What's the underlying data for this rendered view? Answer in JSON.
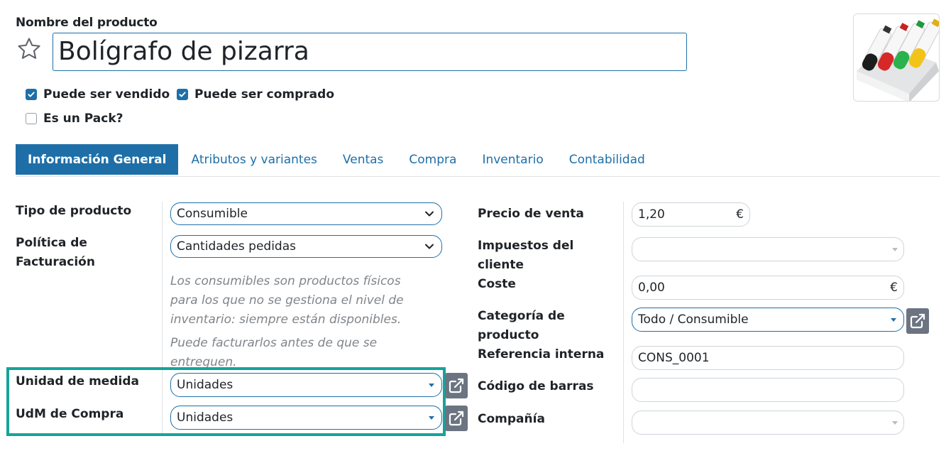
{
  "header": {
    "field_title": "Nombre del producto",
    "product_name": "Bolígrafo de pizarra"
  },
  "checkboxes": {
    "sale_ok": {
      "label": "Puede ser vendido",
      "checked": true
    },
    "purchase_ok": {
      "label": "Puede ser comprado",
      "checked": true
    },
    "is_pack": {
      "label": "Es un Pack?",
      "checked": false
    }
  },
  "tabs": [
    {
      "label": "Información General",
      "active": true
    },
    {
      "label": "Atributos y variantes",
      "active": false
    },
    {
      "label": "Ventas",
      "active": false
    },
    {
      "label": "Compra",
      "active": false
    },
    {
      "label": "Inventario",
      "active": false
    },
    {
      "label": "Contabilidad",
      "active": false
    }
  ],
  "left": {
    "product_type": {
      "label": "Tipo de producto",
      "value": "Consumible"
    },
    "invoice_policy": {
      "label_line1": "Política de",
      "label_line2": "Facturación",
      "value": "Cantidades pedidas"
    },
    "help_1": [
      "Los consumibles son productos físicos",
      "para los que no se gestiona el nivel de",
      "inventario: siempre están disponibles."
    ],
    "help_2": [
      "Puede facturarlos antes de que se",
      "entreguen."
    ],
    "uom": {
      "label": "Unidad de medida",
      "value": "Unidades"
    },
    "uom_po": {
      "label": "UdM de Compra",
      "value": "Unidades"
    }
  },
  "right": {
    "list_price": {
      "label": "Precio de venta",
      "value": "1,20",
      "currency": "€"
    },
    "taxes": {
      "label_line1": "Impuestos del",
      "label_line2": "cliente",
      "value": ""
    },
    "cost": {
      "label": "Coste",
      "value": "0,00",
      "currency": "€"
    },
    "category": {
      "label_line1": "Categoría de",
      "label_line2": "producto",
      "value": "Todo / Consumible"
    },
    "internal_ref": {
      "label": "Referencia interna",
      "value": "CONS_0001"
    },
    "barcode": {
      "label": "Código de barras",
      "value": ""
    },
    "company": {
      "label": "Compañía",
      "value": ""
    }
  },
  "icons": {
    "favorite": "star-outline-icon",
    "external_link": "external-link-icon",
    "dropdown": "chevron-down-icon"
  },
  "colors": {
    "accent": "#1e6fa8",
    "highlight": "#17a39b",
    "button_grey": "#6c7482"
  }
}
